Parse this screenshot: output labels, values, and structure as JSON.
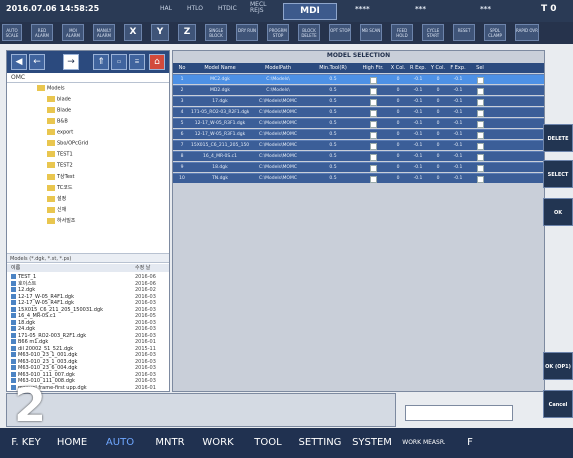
{
  "status": {
    "datetime": "2016.07.06 14:58:25",
    "items": [
      "HAL",
      "HTLO",
      "HTDIC",
      "MECL\nREJS"
    ],
    "mode": "MDI",
    "stars": [
      "****",
      "***",
      "***"
    ],
    "tool": "T 0"
  },
  "toolbar": {
    "buttons": [
      "AUTO SCALE",
      "RED ALARM",
      "MOI ALARM",
      "MAN/LY ALARM",
      "X",
      "Y",
      "Z",
      "SINGLE BLOCK",
      "DRY RUN",
      "PROGRM STOP",
      "BLOCK DELETE",
      "OPT STOP",
      "MB SCAN",
      "FEED HOLD",
      "CYCLE START",
      "RESET",
      "SPDL CLAMP",
      "RAPID OVR"
    ]
  },
  "left": {
    "path": "OMC",
    "tree": [
      "Models",
      "blade",
      "Blade",
      "B&B",
      "export",
      "Sbo/OPcGrid",
      "TEST1",
      "TEST2",
      "T상Test",
      "TC코드",
      "설정",
      "신재",
      "하서밀조"
    ],
    "filter": "Models (*.dgk, *.st, *.ps)",
    "files_header": "이름",
    "files_header_date": "수정 날",
    "files": [
      {
        "name": "TEST_1",
        "date": "2016-06"
      },
      {
        "name": "호이스트",
        "date": "2016-06"
      },
      {
        "name": "12.dgk",
        "date": "2016-02"
      },
      {
        "name": "12-17_W-05_R4F1.dgk",
        "date": "2016-03"
      },
      {
        "name": "12-17_W-05_R4F1.dgk",
        "date": "2016-03"
      },
      {
        "name": "15X015_C6_211_205_150031.dgk",
        "date": "2016-03"
      },
      {
        "name": "16_4_MR-0S.c1",
        "date": "2016-05"
      },
      {
        "name": "18.dgk",
        "date": "2016-03"
      },
      {
        "name": "24.dgk",
        "date": "2016-03"
      },
      {
        "name": "171-05_RO2-003_R2F1.dgk",
        "date": "2016-03"
      },
      {
        "name": "B66 m1.dgk",
        "date": "2016-01"
      },
      {
        "name": "dil 20002_51_521.dgk",
        "date": "2015-11"
      },
      {
        "name": "M63-010_23_1_001.dgk",
        "date": "2016-03"
      },
      {
        "name": "M63-010_23_1_003.dgk",
        "date": "2016-03"
      },
      {
        "name": "M63-010_23_6_004.dgk",
        "date": "2016-03"
      },
      {
        "name": "M63-010_111_007.dgk",
        "date": "2016-03"
      },
      {
        "name": "M63-010_111_008.dgk",
        "date": "2016-03"
      },
      {
        "name": "manual frame-first upp.dgk",
        "date": "2016-01"
      }
    ]
  },
  "model_selection": {
    "title": "MODEL SELECTION",
    "columns": [
      "No",
      "Model Name",
      "ModelPath",
      "Min.Tool(R)",
      "High Ftr.",
      "X Col.",
      "R Exp.",
      "Y Col.",
      "F Exp.",
      "Sel"
    ],
    "rows": [
      {
        "no": "1",
        "name": "MC2.dgk",
        "path": "C:\\Models\\",
        "min": "0.5",
        "x": "0",
        "r": "-0.1",
        "y": "0",
        "f": "-0.1"
      },
      {
        "no": "2",
        "name": "MD2.dgk",
        "path": "C:\\Models\\",
        "min": "0.5",
        "x": "0",
        "r": "-0.1",
        "y": "0",
        "f": "-0.1"
      },
      {
        "no": "3",
        "name": "17.dgk",
        "path": "C:\\Models\\MOMC",
        "min": "0.5",
        "x": "0",
        "r": "-0.1",
        "y": "0",
        "f": "-0.1"
      },
      {
        "no": "4",
        "name": "171-05_RO2-03_R2F1.dgk",
        "path": "C:\\Models\\MOMC",
        "min": "0.5",
        "x": "0",
        "r": "-0.1",
        "y": "0",
        "f": "-0.1"
      },
      {
        "no": "5",
        "name": "12-17_W-05_R3F1.dgk",
        "path": "C:\\Models\\MOMC",
        "min": "0.5",
        "x": "0",
        "r": "-0.1",
        "y": "0",
        "f": "-0.1"
      },
      {
        "no": "6",
        "name": "12-17_W-05_R3F1.dgk",
        "path": "C:\\Models\\MOMC",
        "min": "0.5",
        "x": "0",
        "r": "-0.1",
        "y": "0",
        "f": "-0.1"
      },
      {
        "no": "7",
        "name": "15X015_C6_211_205_150",
        "path": "C:\\Models\\MOMC",
        "min": "0.5",
        "x": "0",
        "r": "-0.1",
        "y": "0",
        "f": "-0.1"
      },
      {
        "no": "8",
        "name": "16_4_MR-0S.c1",
        "path": "C:\\Models\\MOMC",
        "min": "0.5",
        "x": "0",
        "r": "-0.1",
        "y": "0",
        "f": "-0.1"
      },
      {
        "no": "9",
        "name": "18.dgk",
        "path": "C:\\Models\\MOMC",
        "min": "0.5",
        "x": "0",
        "r": "-0.1",
        "y": "0",
        "f": "-0.1"
      },
      {
        "no": "10",
        "name": "TN.dgk",
        "path": "C:\\Models\\MOMC",
        "min": "0.5",
        "x": "0",
        "r": "-0.1",
        "y": "0",
        "f": "-0.1"
      }
    ]
  },
  "right_buttons": [
    "DELETE",
    "SELECT",
    "OK",
    "OK (OP1)",
    "Cancel"
  ],
  "overlay_number": "2",
  "bottom_menu": [
    "F. KEY",
    "HOME",
    "AUTO",
    "MNTR",
    "WORK",
    "TOOL",
    "SETTING",
    "SYSTEM",
    "WORK MEASR.",
    "F"
  ],
  "colors": {
    "accent": "#4d91e6",
    "active_menu": "#6fa7ff",
    "header": "#2b4a7e"
  }
}
